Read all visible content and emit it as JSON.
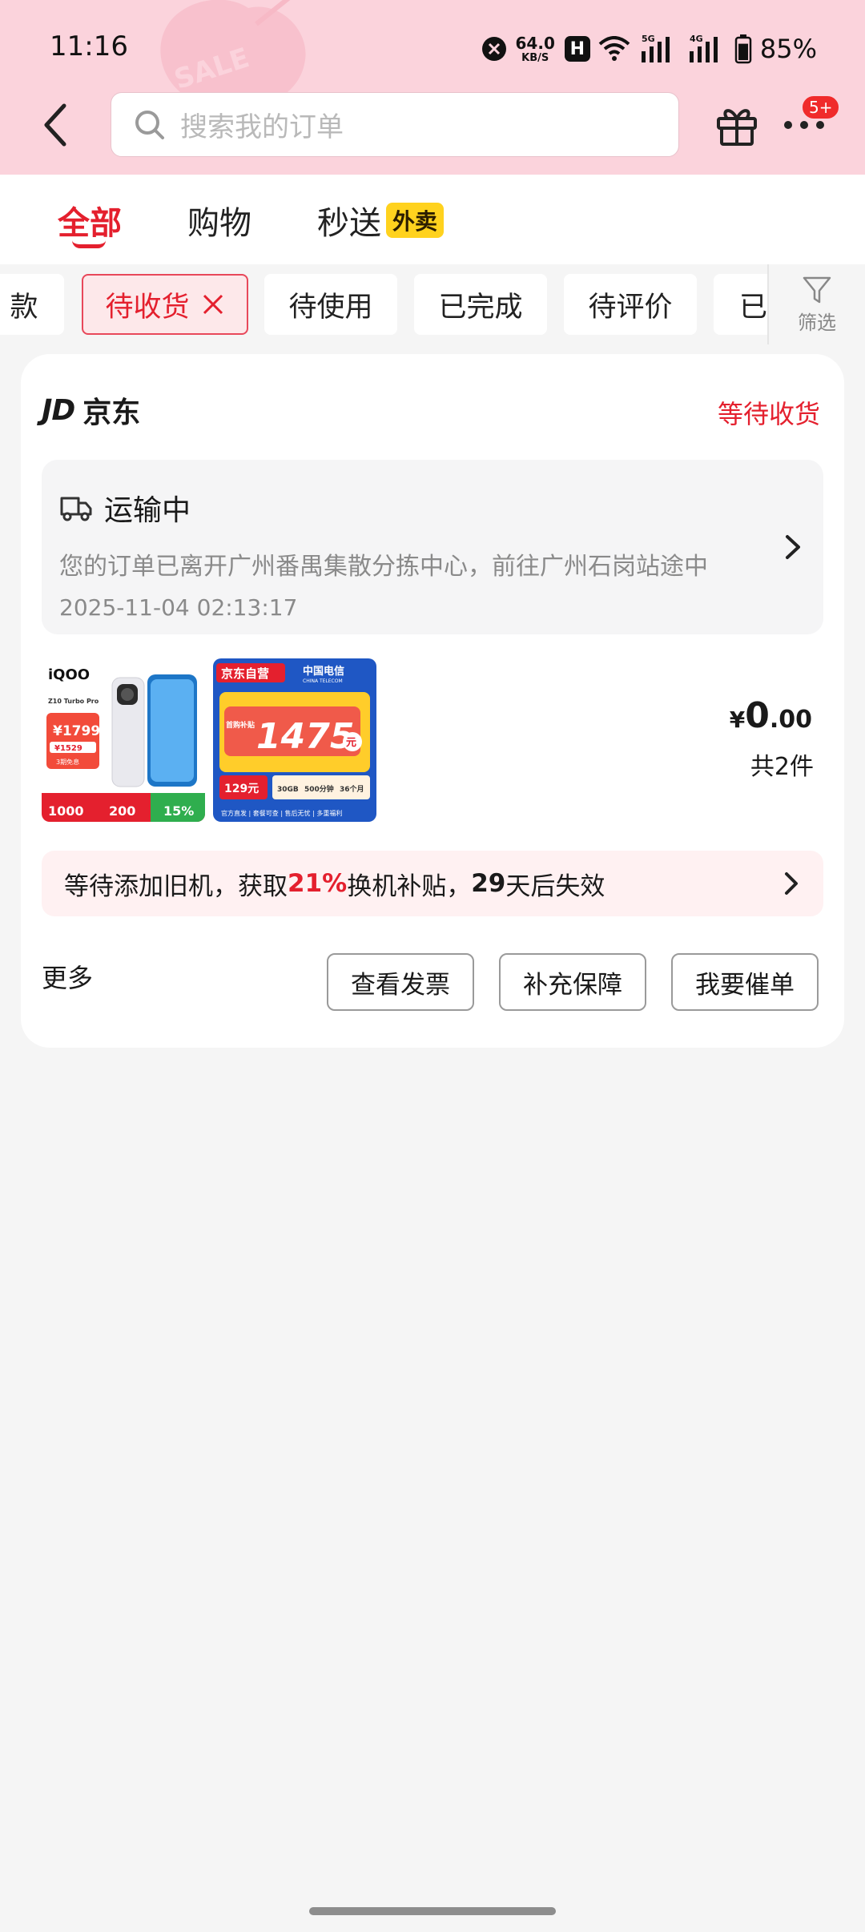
{
  "status_bar": {
    "time": "11:16",
    "net_speed_value": "64.0",
    "net_speed_unit": "KB/S",
    "hd_label": "H",
    "net_5g": "5G",
    "net_4g": "4G",
    "battery_percent": "85%",
    "battery_level": 0.85
  },
  "header": {
    "search_placeholder": "搜索我的订单",
    "more_badge": "5+",
    "deco_text": "SALE"
  },
  "tabs": [
    {
      "label": "全部",
      "active": true
    },
    {
      "label": "购物",
      "active": false
    },
    {
      "label": "秒送",
      "active": false,
      "tag": "外卖"
    }
  ],
  "chips": [
    {
      "label": "款"
    },
    {
      "label": "待收货",
      "active": true
    },
    {
      "label": "待使用"
    },
    {
      "label": "已完成"
    },
    {
      "label": "待评价"
    },
    {
      "label": "已"
    }
  ],
  "filter_label": "筛选",
  "order": {
    "shop_logo": "JD",
    "shop_name": "京东",
    "status": "等待收货",
    "logistics": {
      "title": "运输中",
      "desc": "您的订单已离开广州番禺集散分拣中心，前往广州石岗站途中",
      "time": "2025-11-04 02:13:17"
    },
    "products": [
      {
        "brand": "iQOO",
        "model": "Z10 Turbo Pro",
        "price1": "¥1799",
        "price2": "¥1529",
        "note": "3期免息",
        "tag1": "1000",
        "tag2": "200",
        "tag3": "15%"
      },
      {
        "store": "京东自营",
        "carrier": "中国电信",
        "carrier_en": "CHINA TELECOM",
        "big": "1475",
        "unit": "元",
        "side": "首购补贴",
        "monthly": "129元",
        "f1": "30GB",
        "f2": "500分钟",
        "f3": "36个月",
        "footer": "官方直发 | 套餐可查 | 售后无忧 | 多重福利"
      }
    ],
    "price_currency": "¥",
    "price_int": "0",
    "price_dec": ".00",
    "quantity": "共2件",
    "tradein": {
      "p1": "等待添加旧机，获取",
      "pct": "21%",
      "p2": "换机补贴，",
      "days": "29",
      "p3": "天后失效"
    },
    "more_label": "更多",
    "buttons": [
      "查看发票",
      "补充保障",
      "我要催单"
    ]
  }
}
